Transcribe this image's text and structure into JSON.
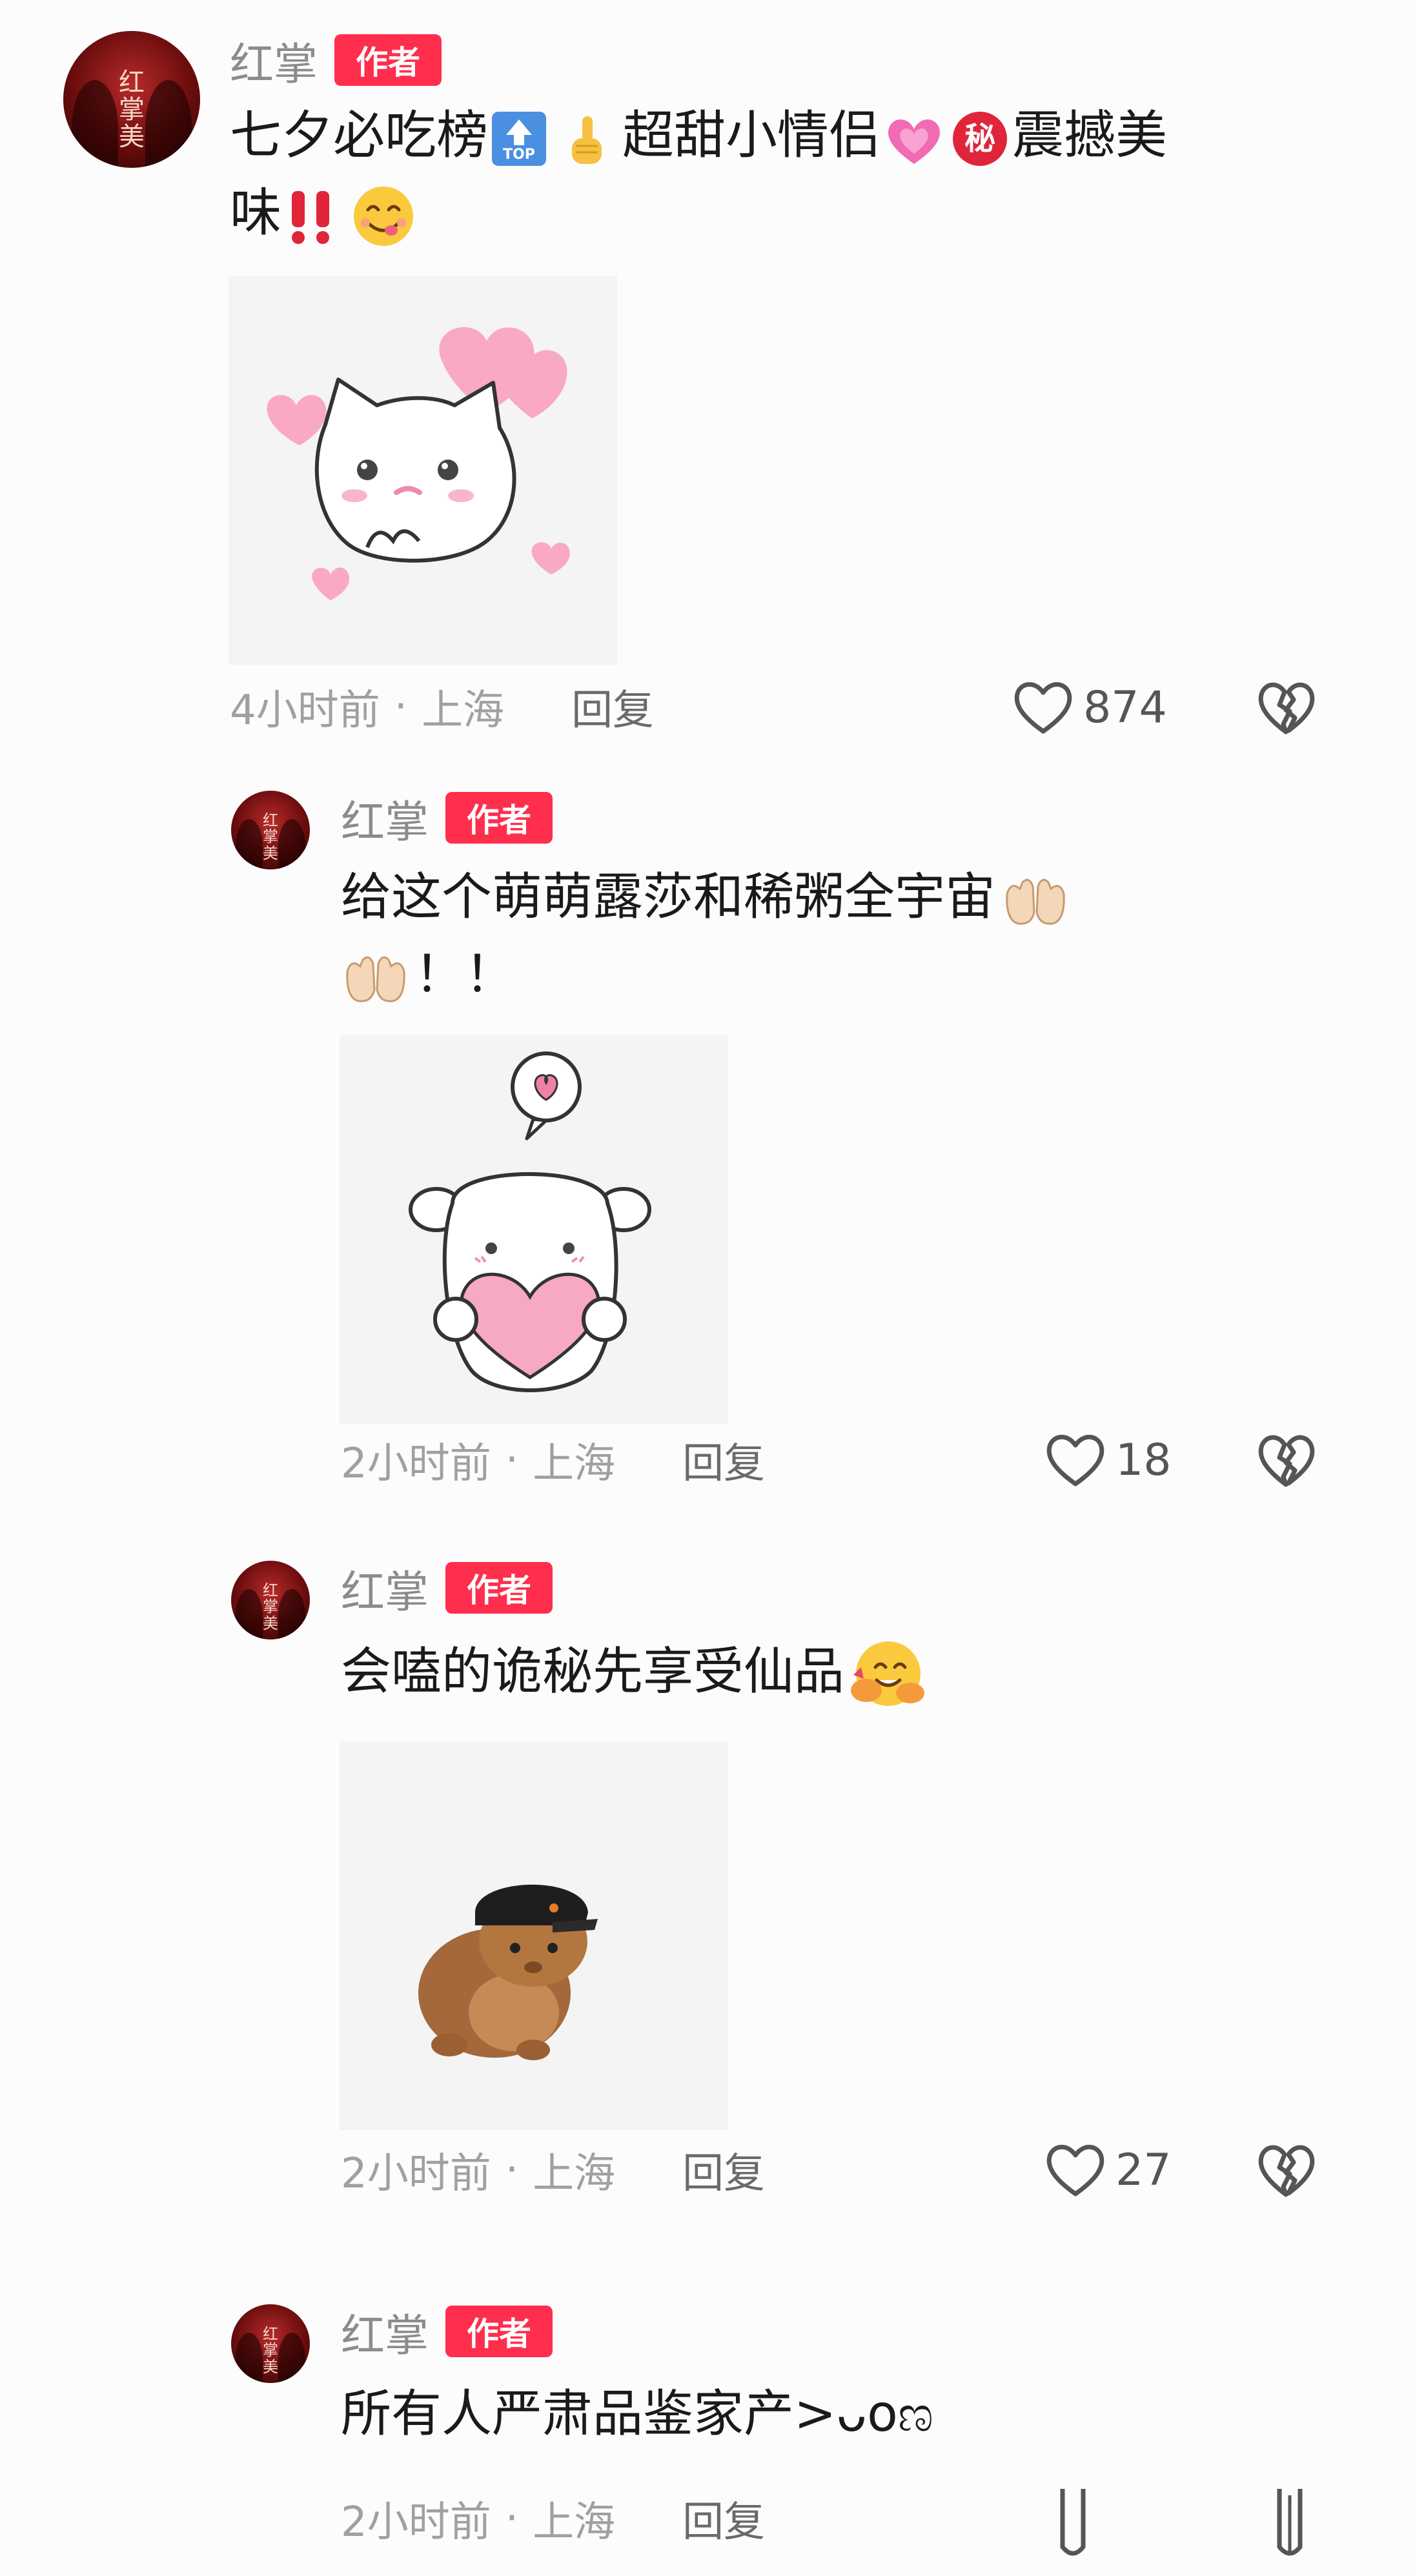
{
  "comments": [
    {
      "username": "红掌",
      "badge": "作者",
      "avatar_text": "红掌美",
      "text_line1_a": "七夕必吃榜",
      "text_line1_b": "超甜小情侣",
      "text_line1_c": "震撼美",
      "text_line2": "味",
      "top_label": "TOP",
      "secret_label": "秘",
      "time": "4小时前",
      "location": "上海",
      "reply": "回复",
      "likes": "874"
    },
    {
      "username": "红掌",
      "badge": "作者",
      "avatar_text": "红掌美",
      "text_line1": "给这个萌萌露莎和稀粥全宇宙",
      "text_line2": "！！",
      "time": "2小时前",
      "location": "上海",
      "reply": "回复",
      "likes": "18"
    },
    {
      "username": "红掌",
      "badge": "作者",
      "avatar_text": "红掌美",
      "text_line1": "会嗑的诡秘先享受仙品",
      "time": "2小时前",
      "location": "上海",
      "reply": "回复",
      "likes": "27"
    },
    {
      "username": "红掌",
      "badge": "作者",
      "avatar_text": "红掌美",
      "text_line1": "所有人严肃品鉴家产>ᴗoಣ",
      "time": "2小时前",
      "location": "上海",
      "reply": "回复"
    }
  ],
  "separator": "·",
  "colors": {
    "badge": "#ff2e4d",
    "meta": "#a0a0a0",
    "text": "#1a1a1a",
    "pink": "#f9a9c4"
  }
}
